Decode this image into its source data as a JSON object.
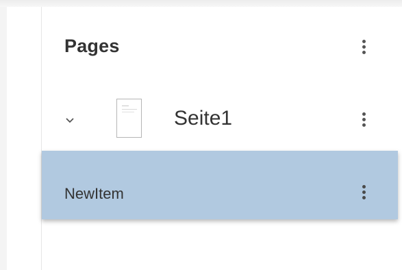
{
  "panel": {
    "title": "Pages"
  },
  "pages": [
    {
      "label": "Seite1",
      "expanded": true,
      "items": [
        {
          "label": "NewItem",
          "selected": true
        }
      ]
    }
  ],
  "icons": {
    "menu": "more-vertical-icon",
    "expand": "chevron-down-icon",
    "thumbnail": "page-thumbnail-icon"
  },
  "colors": {
    "selected_row": "#b1c9e0",
    "text": "#333333"
  }
}
